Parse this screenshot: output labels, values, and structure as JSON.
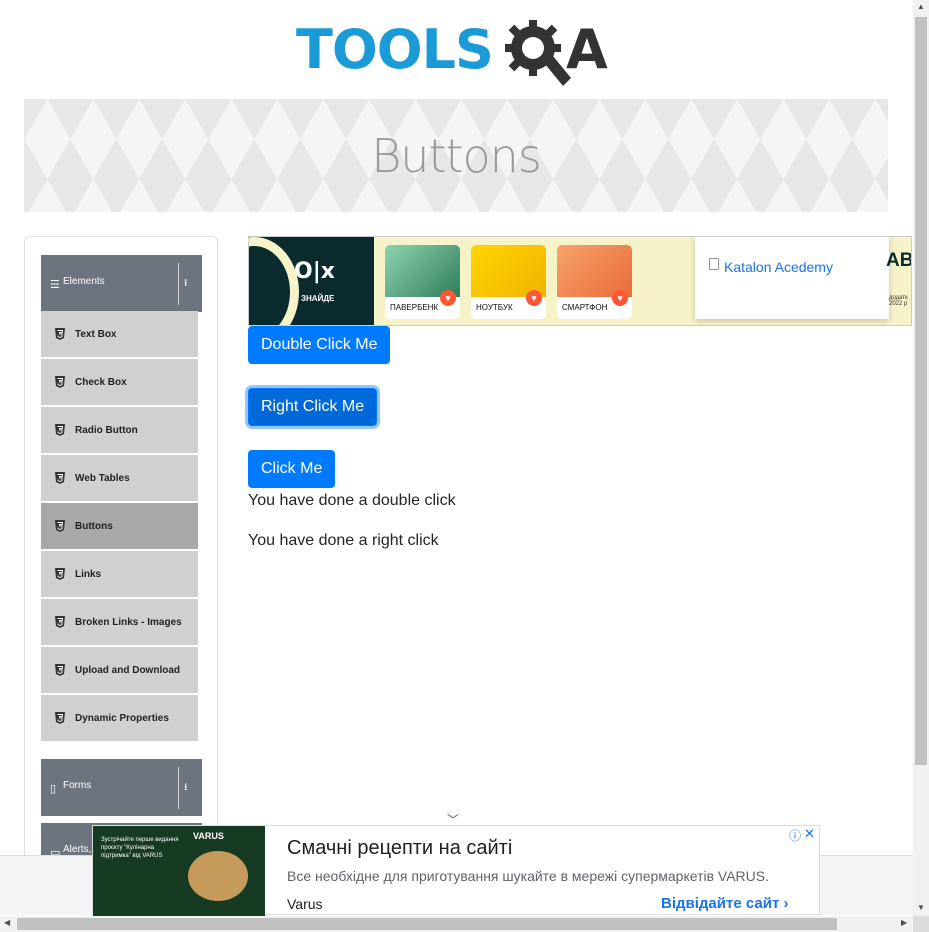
{
  "header": {
    "logo_text": "TOOLS",
    "logo_text_end": "A"
  },
  "banner": {
    "title": "Buttons"
  },
  "sidebar": {
    "groups": [
      {
        "label": "Elements",
        "expanded": true
      },
      {
        "label": "Forms",
        "expanded": false
      },
      {
        "label": "Alerts,"
      }
    ],
    "items": [
      {
        "label": "Text Box"
      },
      {
        "label": "Check Box"
      },
      {
        "label": "Radio Button"
      },
      {
        "label": "Web Tables"
      },
      {
        "label": "Buttons",
        "active": true
      },
      {
        "label": "Links"
      },
      {
        "label": "Broken Links - Images"
      },
      {
        "label": "Upload and Download"
      },
      {
        "label": "Dynamic Properties"
      }
    ]
  },
  "ad_top": {
    "brand": "O|x",
    "brand_tag": "ЗНАЙДЕ",
    "products": [
      "ПАВЕРБЕНК",
      "НОУТБУК",
      "СМАРТФОН"
    ],
    "image_alt": "Katalon Acedemy",
    "right_text": "AB",
    "tiny_text": "додатк\n2022 р"
  },
  "main": {
    "double_click_button": "Double Click Me",
    "right_click_button": "Right Click Me",
    "click_button": "Click Me",
    "double_click_message": "You have done a double click",
    "right_click_message": "You have done a right click"
  },
  "ad_bottom": {
    "promo_text": "Зустрічайте перше видання проєкту \"Кулінарна підтримка\" від VARUS",
    "promo_brand": "VARUS",
    "title": "Смачні рецепти на сайті",
    "description": "Все необхідне для приготування шукайте в мережі супермаркетів VARUS.",
    "advertiser": "Varus",
    "cta": "Відвідайте сайт"
  },
  "colors": {
    "primary": "#007bff",
    "sidebar_header": "#6c757d",
    "logo_blue": "#1a9ad6"
  }
}
